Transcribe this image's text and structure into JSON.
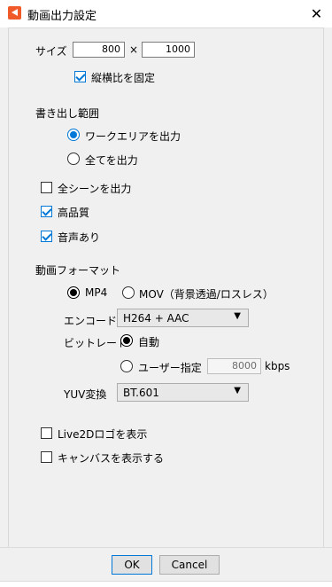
{
  "window": {
    "title": "動画出力設定",
    "close_glyph": "✕"
  },
  "size": {
    "label": "サイズ",
    "width": "800",
    "separator": "×",
    "height": "1000"
  },
  "aspect_lock": {
    "label": "縦横比を固定",
    "checked": true
  },
  "export_range": {
    "heading": "書き出し範囲",
    "options": [
      {
        "label": "ワークエリアを出力",
        "selected": true
      },
      {
        "label": "全てを出力",
        "selected": false
      }
    ]
  },
  "all_scenes": {
    "label": "全シーンを出力",
    "checked": false
  },
  "high_quality": {
    "label": "高品質",
    "checked": true
  },
  "with_audio": {
    "label": "音声あり",
    "checked": true
  },
  "video_format": {
    "heading": "動画フォーマット",
    "formats": [
      {
        "label": "MP4",
        "selected": true
      },
      {
        "label": "MOV（背景透過/ロスレス）",
        "selected": false
      }
    ],
    "encode": {
      "label": "エンコード",
      "value": "H264 + AAC"
    },
    "bitrate": {
      "label": "ビットレート",
      "auto_label": "自動",
      "user_label": "ユーザー指定",
      "value": "8000",
      "unit": "kbps"
    },
    "yuv": {
      "label": "YUV変換",
      "value": "BT.601"
    }
  },
  "live2d_logo": {
    "label": "Live2Dロゴを表示",
    "checked": false
  },
  "show_canvas": {
    "label": "キャンバスを表示する",
    "checked": false
  },
  "buttons": {
    "ok": "OK",
    "cancel": "Cancel"
  }
}
